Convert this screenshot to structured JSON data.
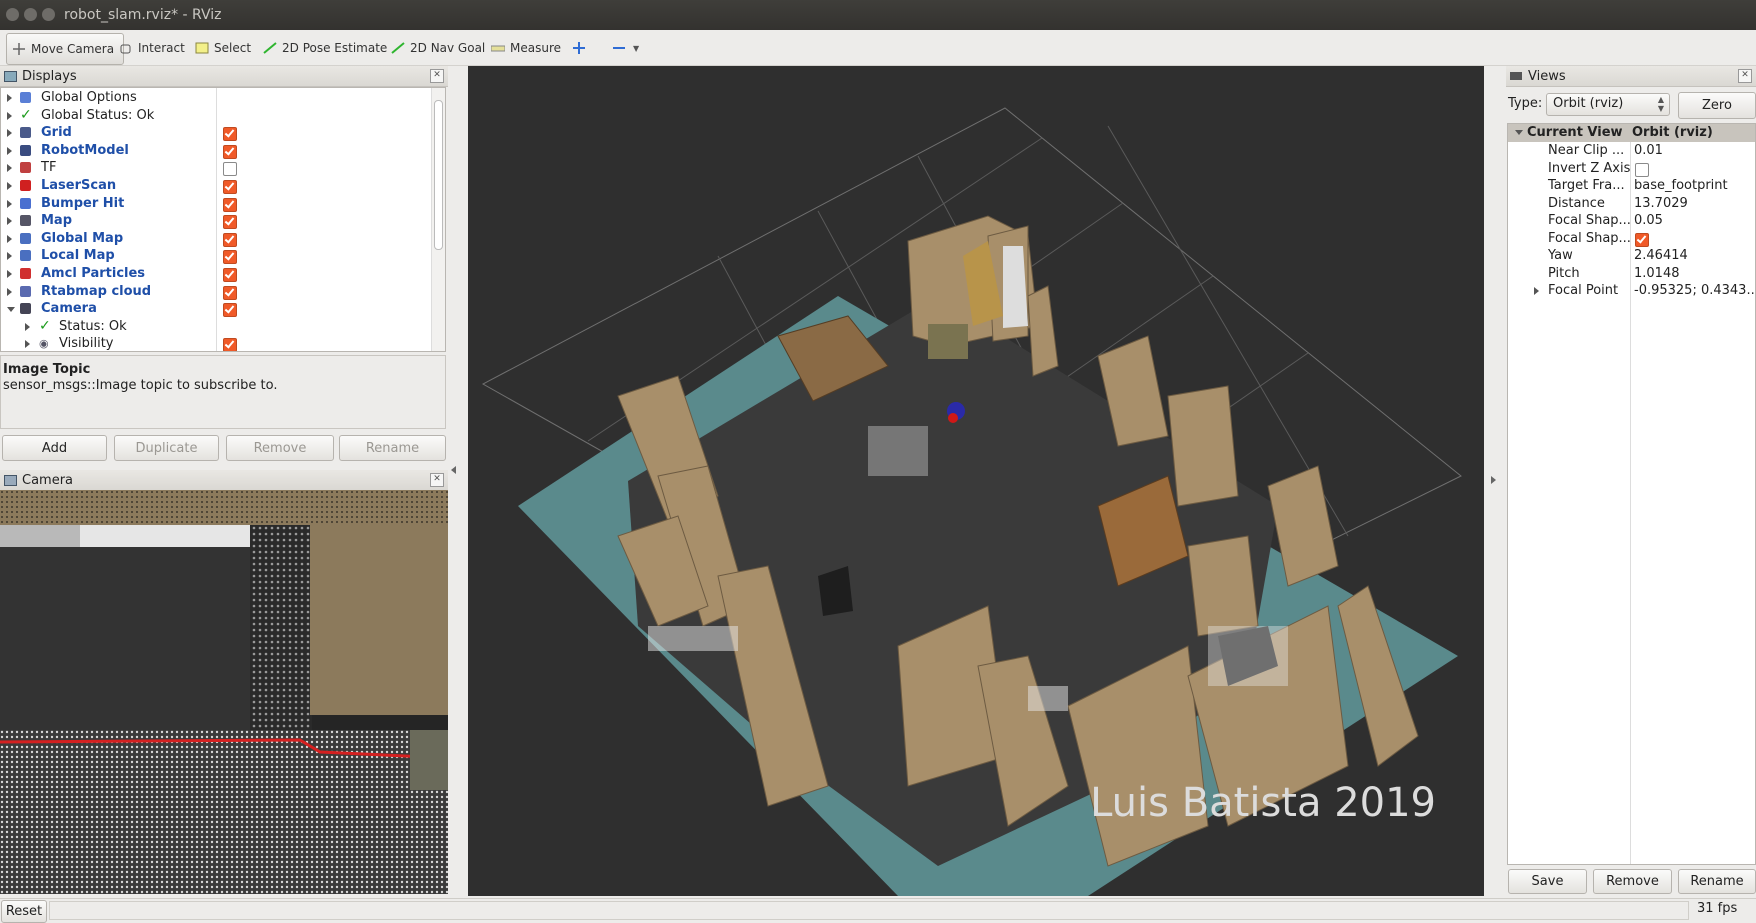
{
  "window": {
    "title": "robot_slam.rviz* - RViz"
  },
  "toolbar": {
    "move_camera": "Move Camera",
    "interact": "Interact",
    "select": "Select",
    "pose_estimate": "2D Pose Estimate",
    "nav_goal": "2D Nav Goal",
    "measure": "Measure"
  },
  "displays": {
    "title": "Displays",
    "items": [
      {
        "label": "Global Options",
        "style": "normal",
        "checked": null
      },
      {
        "label": "Global Status: Ok",
        "style": "normal",
        "checked": null
      },
      {
        "label": "Grid",
        "style": "blue",
        "checked": true
      },
      {
        "label": "RobotModel",
        "style": "blue",
        "checked": true
      },
      {
        "label": "TF",
        "style": "normal",
        "checked": false
      },
      {
        "label": "LaserScan",
        "style": "blue",
        "checked": true
      },
      {
        "label": "Bumper Hit",
        "style": "blue",
        "checked": true
      },
      {
        "label": "Map",
        "style": "blue",
        "checked": true
      },
      {
        "label": "Global Map",
        "style": "blue",
        "checked": true
      },
      {
        "label": "Local Map",
        "style": "blue",
        "checked": true
      },
      {
        "label": "Amcl Particles",
        "style": "blue",
        "checked": true
      },
      {
        "label": "Rtabmap cloud",
        "style": "blue",
        "checked": true
      },
      {
        "label": "Camera",
        "style": "blue",
        "checked": true
      },
      {
        "label": "Status: Ok",
        "style": "normal",
        "checked": null
      },
      {
        "label": "Visibility",
        "style": "normal",
        "checked": true
      }
    ],
    "desc_title": "Image Topic",
    "desc_text": "sensor_msgs::Image topic to subscribe to.",
    "add": "Add",
    "duplicate": "Duplicate",
    "remove": "Remove",
    "rename": "Rename"
  },
  "camera": {
    "title": "Camera"
  },
  "views": {
    "title": "Views",
    "type_label": "Type:",
    "type_value": "Orbit (rviz)",
    "zero": "Zero",
    "current_view": "Current View",
    "current_view_value": "Orbit (rviz)",
    "props": [
      {
        "name": "Near Clip ...",
        "value": "0.01"
      },
      {
        "name": "Invert Z Axis",
        "value": ""
      },
      {
        "name": "Target Fra...",
        "value": "base_footprint"
      },
      {
        "name": "Distance",
        "value": "13.7029"
      },
      {
        "name": "Focal Shap...",
        "value": "0.05"
      },
      {
        "name": "Focal Shap...",
        "value": ""
      },
      {
        "name": "Yaw",
        "value": "2.46414"
      },
      {
        "name": "Pitch",
        "value": "1.0148"
      },
      {
        "name": "Focal Point",
        "value": "-0.95325; 0.4343..."
      }
    ],
    "save": "Save",
    "remove": "Remove",
    "rename": "Rename"
  },
  "viewport": {
    "watermark": "Luis Batista 2019"
  },
  "status": {
    "reset": "Reset",
    "fps": "31 fps"
  },
  "colors": {
    "accent_checkbox": "#f05a28",
    "blue_label": "#1f4fa8",
    "viewport_bg": "#2f2f2f",
    "floor": "#5a8a8c",
    "wall": "#a88f6a"
  }
}
